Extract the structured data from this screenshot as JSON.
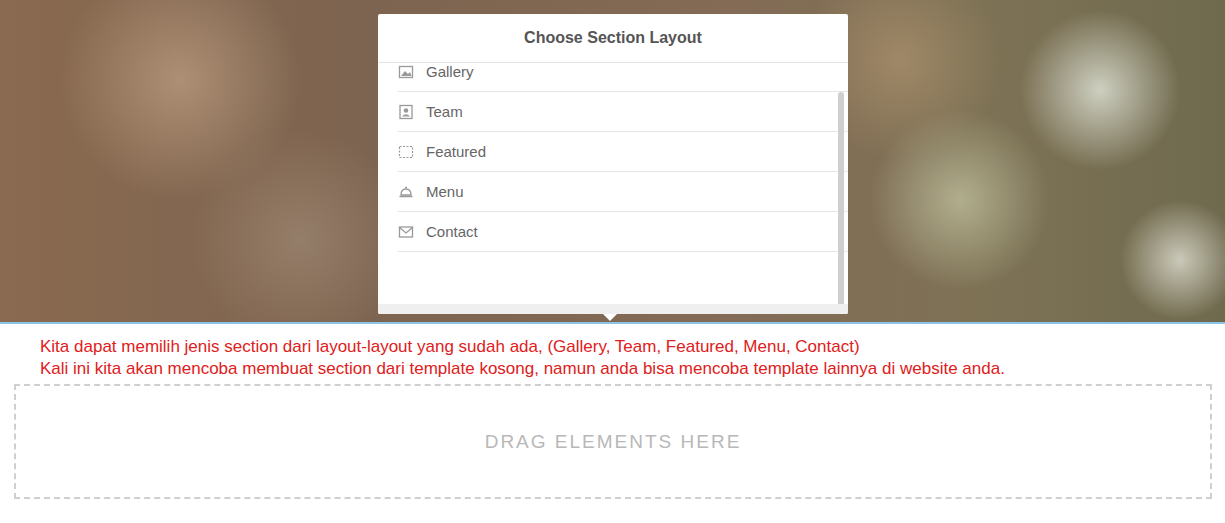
{
  "popup": {
    "title": "Choose Section Layout",
    "items": [
      {
        "label": "Gallery"
      },
      {
        "label": "Team"
      },
      {
        "label": "Featured"
      },
      {
        "label": "Menu"
      },
      {
        "label": "Contact"
      }
    ]
  },
  "caption": [
    "Kita dapat memilih jenis section dari layout-layout yang sudah ada, (Gallery, Team, Featured, Menu, Contact)",
    "Kali ini kita akan mencoba membuat section dari template kosong, namun anda bisa mencoba template lainnya di website anda."
  ],
  "dropzone": {
    "label": "DRAG ELEMENTS HERE"
  }
}
